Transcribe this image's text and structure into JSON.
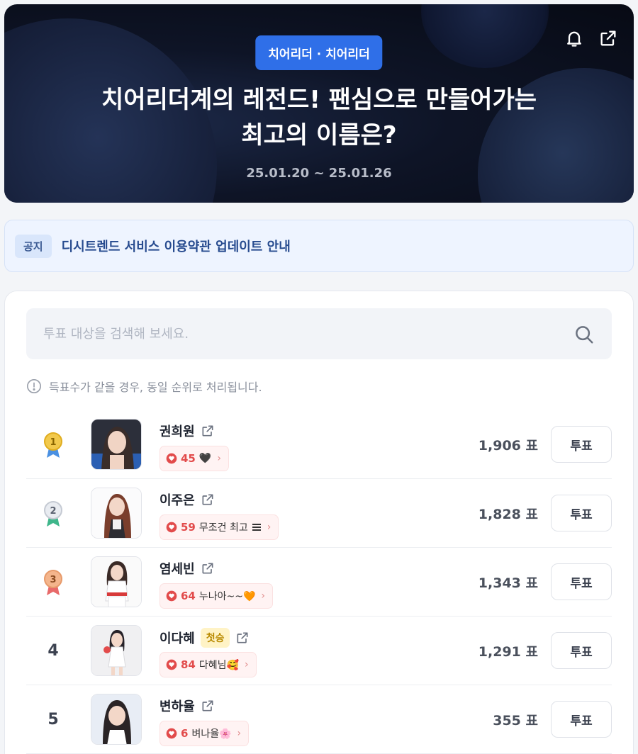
{
  "header": {
    "category": "치어리더 · 치어리더",
    "title_line1": "치어리더계의 레전드! 팬심으로 만들어가는",
    "title_line2": "최고의 이름은?",
    "date_range": "25.01.20 ~ 25.01.26",
    "icons": [
      "bell-icon",
      "share-icon"
    ]
  },
  "notice": {
    "tag": "공지",
    "text": "디시트렌드 서비스 이용약관 업데이트 안내"
  },
  "search": {
    "placeholder": "투표 대상을 검색해 보세요."
  },
  "tip": "득표수가 같을 경우, 동일 순위로 처리됩니다.",
  "colors": {
    "accent": "#2f6fe8",
    "heart": "#e24b4b",
    "gold": "#e9b826",
    "silver": "#c5cad3",
    "bronze": "#e79a6a"
  },
  "rankings": [
    {
      "rank": "1",
      "medal": "gold",
      "name": "권희원",
      "badge": "",
      "cheer_count": "45",
      "cheer_msg": "🖤",
      "votes": "1,906 표",
      "vote_label": "투표"
    },
    {
      "rank": "2",
      "medal": "silver",
      "name": "이주은",
      "badge": "",
      "cheer_count": "59",
      "cheer_msg": "무조건 최고",
      "votes": "1,828 표",
      "vote_label": "투표"
    },
    {
      "rank": "3",
      "medal": "bronze",
      "name": "염세빈",
      "badge": "",
      "cheer_count": "64",
      "cheer_msg": "누나아~~🧡",
      "votes": "1,343 표",
      "vote_label": "투표"
    },
    {
      "rank": "4",
      "medal": "",
      "name": "이다혜",
      "badge": "첫승",
      "cheer_count": "84",
      "cheer_msg": "다혜님🥰",
      "votes": "1,291 표",
      "vote_label": "투표"
    },
    {
      "rank": "5",
      "medal": "",
      "name": "변하율",
      "badge": "",
      "cheer_count": "6",
      "cheer_msg": "벼나율🌸",
      "votes": "355 표",
      "vote_label": "투표"
    }
  ]
}
